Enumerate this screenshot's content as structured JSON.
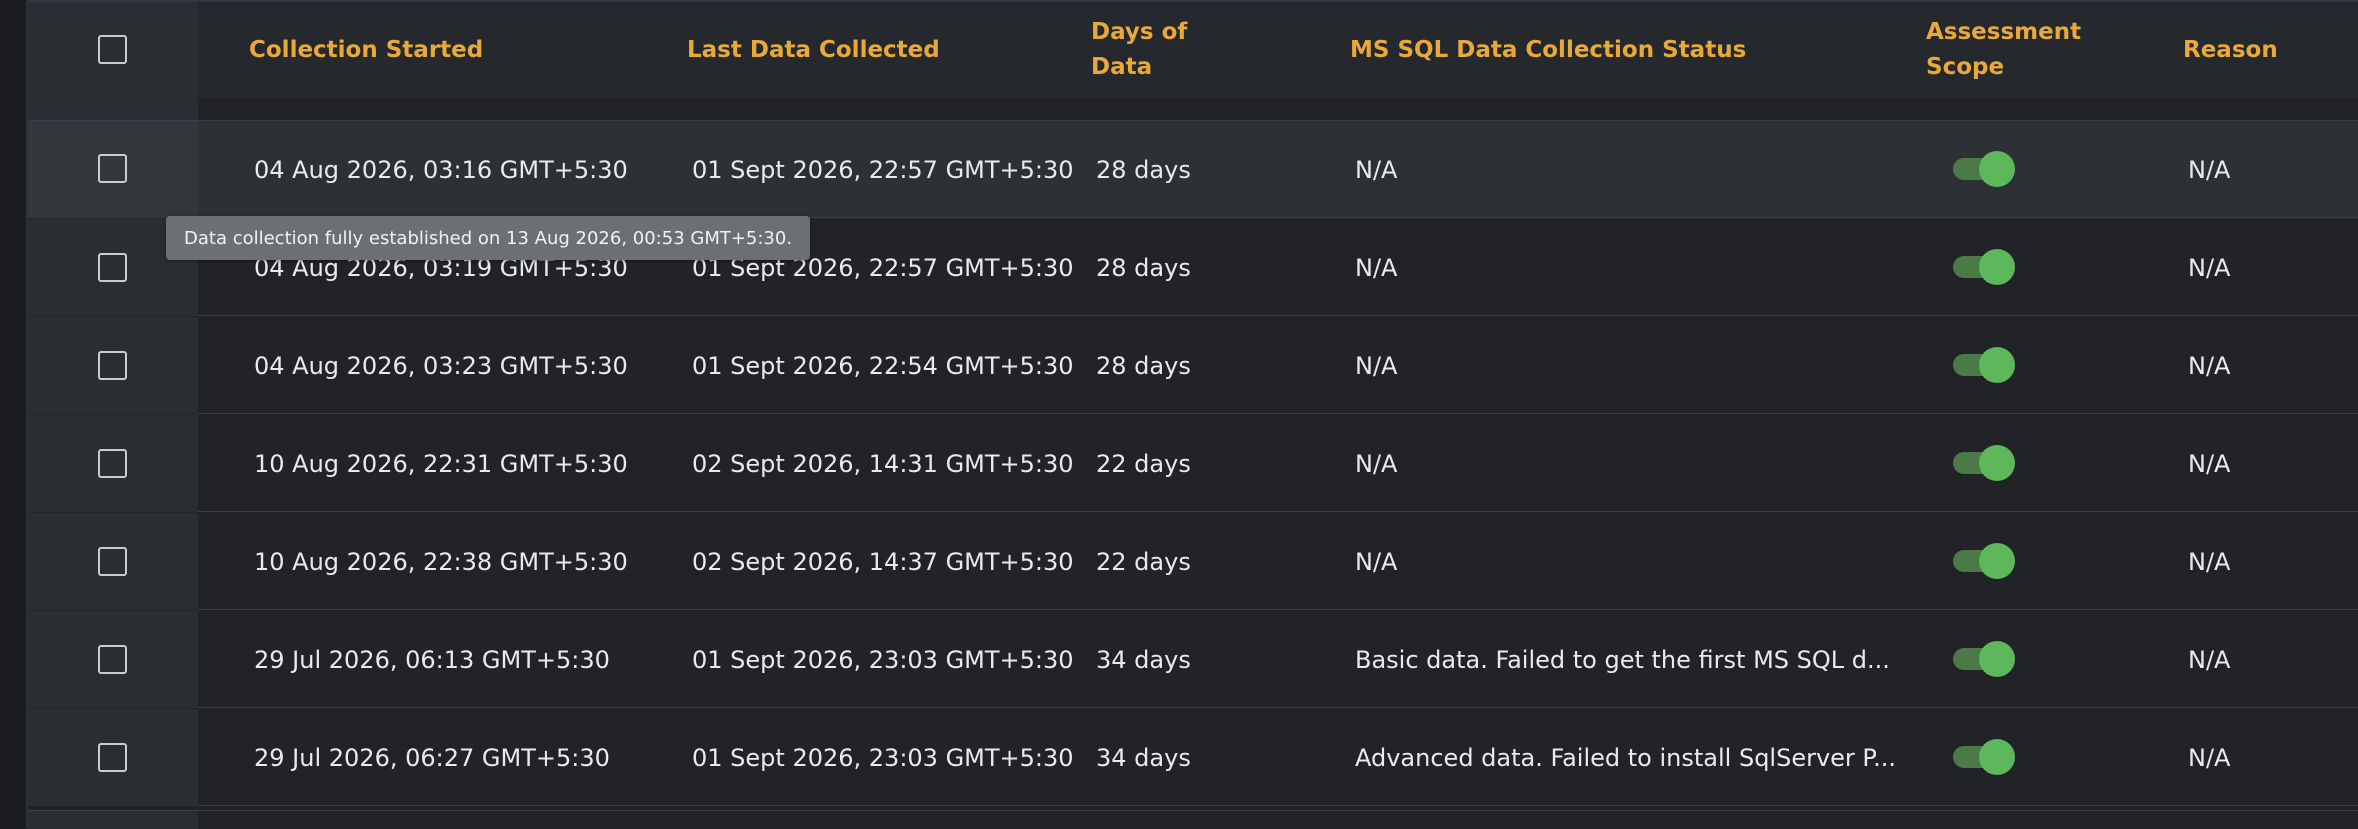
{
  "table": {
    "columns": {
      "collection_started": "Collection Started",
      "last_data_collected": "Last Data Collected",
      "days_of_data": "Days of\nData",
      "mssql_status": "MS SQL Data Collection Status",
      "assessment_scope": "Assessment\nScope",
      "reason": "Reason"
    },
    "rows": [
      {
        "collection_started": "04 Aug 2026, 03:16 GMT+5:30",
        "last_data_collected": "01 Sept 2026, 22:57 GMT+5:30",
        "days_of_data": "28 days",
        "mssql_status": "N/A",
        "assessment_scope_on": true,
        "reason": "N/A"
      },
      {
        "collection_started": "04 Aug 2026, 03:19 GMT+5:30",
        "last_data_collected": "01 Sept 2026, 22:57 GMT+5:30",
        "days_of_data": "28 days",
        "mssql_status": "N/A",
        "assessment_scope_on": true,
        "reason": "N/A"
      },
      {
        "collection_started": "04 Aug 2026, 03:23 GMT+5:30",
        "last_data_collected": "01 Sept 2026, 22:54 GMT+5:30",
        "days_of_data": "28 days",
        "mssql_status": "N/A",
        "assessment_scope_on": true,
        "reason": "N/A"
      },
      {
        "collection_started": "10 Aug 2026, 22:31 GMT+5:30",
        "last_data_collected": "02 Sept 2026, 14:31 GMT+5:30",
        "days_of_data": "22 days",
        "mssql_status": "N/A",
        "assessment_scope_on": true,
        "reason": "N/A"
      },
      {
        "collection_started": "10 Aug 2026, 22:38 GMT+5:30",
        "last_data_collected": "02 Sept 2026, 14:37 GMT+5:30",
        "days_of_data": "22 days",
        "mssql_status": "N/A",
        "assessment_scope_on": true,
        "reason": "N/A"
      },
      {
        "collection_started": "29 Jul 2026, 06:13 GMT+5:30",
        "last_data_collected": "01 Sept 2026, 23:03 GMT+5:30",
        "days_of_data": "34 days",
        "mssql_status": "Basic data. Failed to get the first MS SQL d...",
        "assessment_scope_on": true,
        "reason": "N/A"
      },
      {
        "collection_started": "29 Jul 2026, 06:27 GMT+5:30",
        "last_data_collected": "01 Sept 2026, 23:03 GMT+5:30",
        "days_of_data": "34 days",
        "mssql_status": "Advanced data. Failed to install SqlServer P...",
        "assessment_scope_on": true,
        "reason": "N/A"
      }
    ]
  },
  "tooltip": {
    "text": "Data collection fully established on 13 Aug 2026, 00:53 GMT+5:30."
  },
  "colors": {
    "header_text": "#e9a93a",
    "toggle_on": "#5cb85a",
    "background": "#212327"
  }
}
